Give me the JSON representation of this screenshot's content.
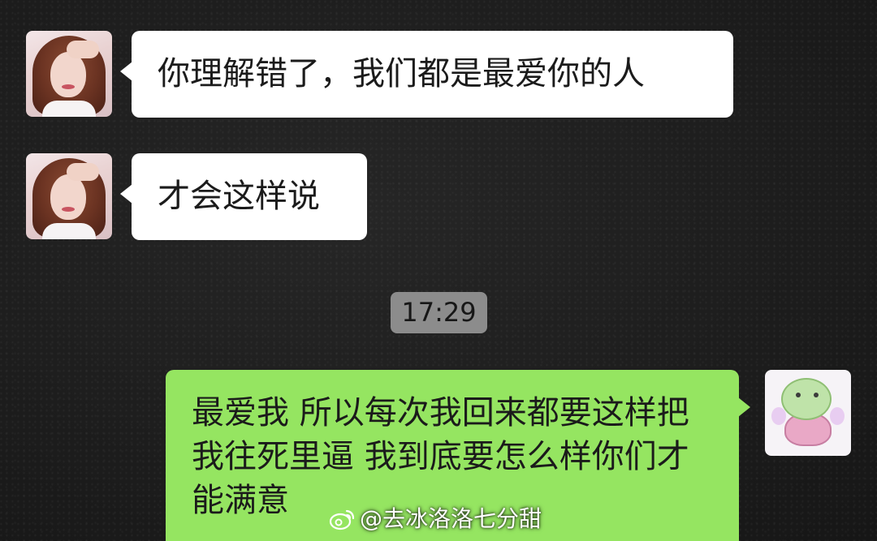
{
  "messages": [
    {
      "direction": "incoming",
      "sender_avatar": "girl-photo-avatar",
      "text": "你理解错了，我们都是最爱你的人"
    },
    {
      "direction": "incoming",
      "sender_avatar": "girl-photo-avatar",
      "text": "才会这样说"
    },
    {
      "direction": "outgoing",
      "sender_avatar": "turtle-sticker-avatar",
      "text": "最爱我 所以每次我回来都要这样把我往死里逼 我到底要怎么样你们才能满意"
    }
  ],
  "timestamp": "17:29",
  "watermark": {
    "icon": "weibo-icon",
    "text": "@去冰洛洛七分甜"
  },
  "colors": {
    "background": "#1c1c1c",
    "incoming_bubble": "#ffffff",
    "outgoing_bubble": "#95e561",
    "timestamp_bg": "#8c8c8c"
  }
}
